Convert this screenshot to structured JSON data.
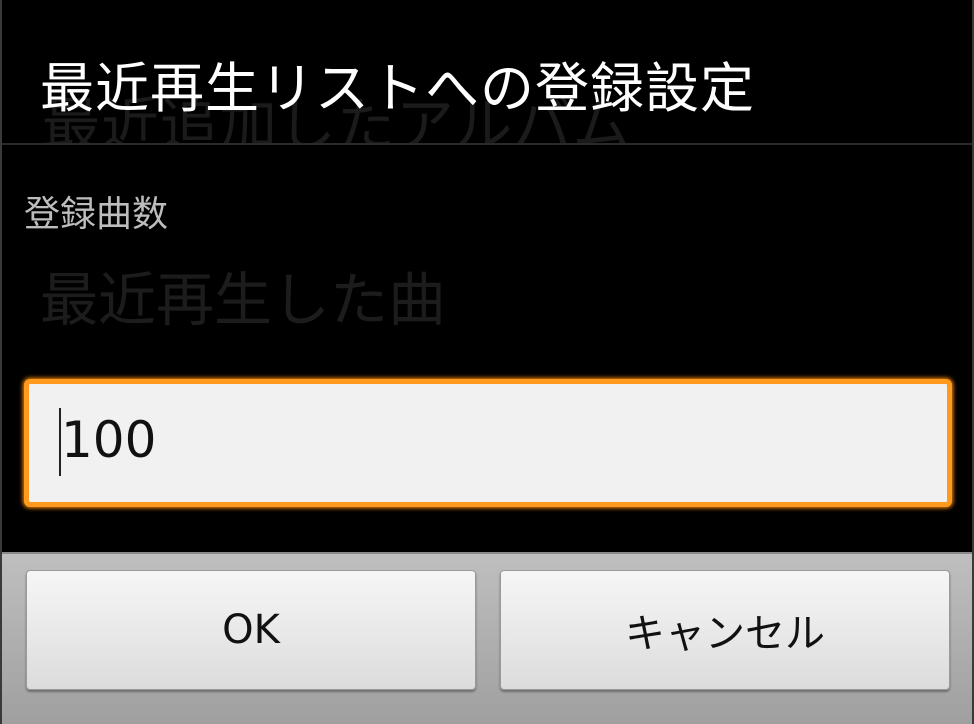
{
  "dialog": {
    "title": "最近再生リストへの登録設定",
    "background_title": "最近追加したアルバム",
    "field_label": "登録曲数",
    "background_subtitle": "最近再生した曲",
    "input_value": "100",
    "ok_label": "OK",
    "cancel_label": "キャンセル"
  },
  "colors": {
    "accent": "#ff9a1f",
    "dialog_bg": "#000000",
    "button_bar": "#a8a8a8"
  },
  "icons": []
}
